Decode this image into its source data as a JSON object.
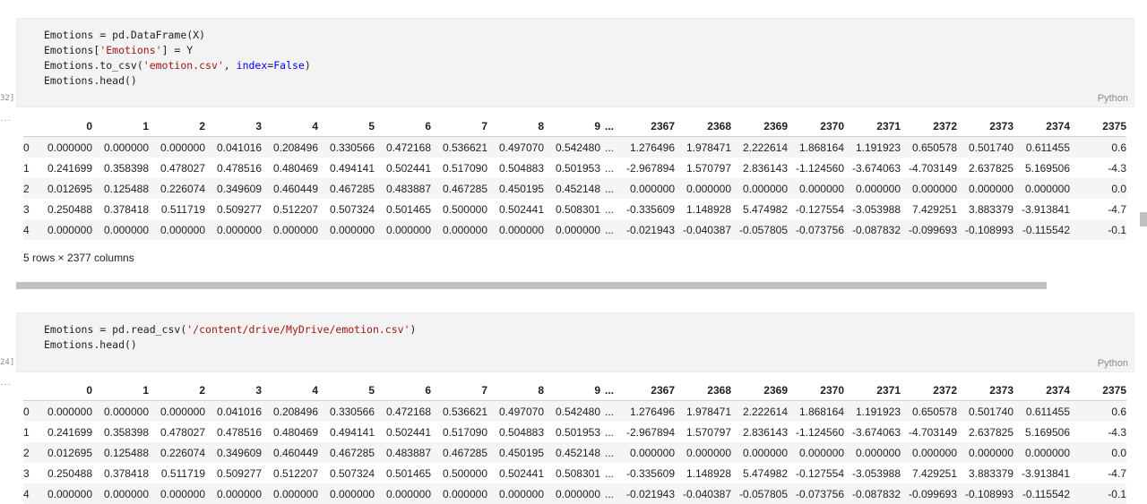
{
  "cell1": {
    "exec_count": "32]",
    "code_lines": [
      [
        [
          "p",
          "Emotions = pd.DataFrame(X)"
        ]
      ],
      [
        [
          "p",
          "Emotions["
        ],
        [
          "s",
          "'Emotions'"
        ],
        [
          "p",
          "] = Y"
        ]
      ],
      [
        [
          "p",
          "Emotions.to_csv("
        ],
        [
          "s",
          "'emotion.csv'"
        ],
        [
          "p",
          ", "
        ],
        [
          "k",
          "index"
        ],
        [
          "p",
          "="
        ],
        [
          "k",
          "False"
        ],
        [
          "p",
          ")"
        ]
      ],
      [
        [
          "p",
          "Emotions.head()"
        ]
      ]
    ],
    "language": "Python",
    "output_indicator": "..."
  },
  "cell2": {
    "exec_count": "24]",
    "code_lines": [
      [
        [
          "p",
          "Emotions = pd.read_csv("
        ],
        [
          "s",
          "'/content/drive/MyDrive/emotion.csv'"
        ],
        [
          "p",
          ")"
        ]
      ],
      [
        [
          "p",
          "Emotions.head()"
        ]
      ]
    ],
    "language": "Python",
    "output_indicator": "..."
  },
  "dataframe": {
    "columns": [
      "0",
      "1",
      "2",
      "3",
      "4",
      "5",
      "6",
      "7",
      "8",
      "9",
      "...",
      "2367",
      "2368",
      "2369",
      "2370",
      "2371",
      "2372",
      "2373",
      "2374",
      "2375"
    ],
    "rows": [
      {
        "index": "0",
        "values": [
          "0.000000",
          "0.000000",
          "0.000000",
          "0.041016",
          "0.208496",
          "0.330566",
          "0.472168",
          "0.536621",
          "0.497070",
          "0.542480",
          "...",
          "1.276496",
          "1.978471",
          "2.222614",
          "1.868164",
          "1.191923",
          "0.650578",
          "0.501740",
          "0.611455",
          "0.6"
        ]
      },
      {
        "index": "1",
        "values": [
          "0.241699",
          "0.358398",
          "0.478027",
          "0.478516",
          "0.480469",
          "0.494141",
          "0.502441",
          "0.517090",
          "0.504883",
          "0.501953",
          "...",
          "-2.967894",
          "1.570797",
          "2.836143",
          "-1.124560",
          "-3.674063",
          "-4.703149",
          "2.637825",
          "5.169506",
          "-4.3"
        ]
      },
      {
        "index": "2",
        "values": [
          "0.012695",
          "0.125488",
          "0.226074",
          "0.349609",
          "0.460449",
          "0.467285",
          "0.483887",
          "0.467285",
          "0.450195",
          "0.452148",
          "...",
          "0.000000",
          "0.000000",
          "0.000000",
          "0.000000",
          "0.000000",
          "0.000000",
          "0.000000",
          "0.000000",
          "0.0"
        ]
      },
      {
        "index": "3",
        "values": [
          "0.250488",
          "0.378418",
          "0.511719",
          "0.509277",
          "0.512207",
          "0.507324",
          "0.501465",
          "0.500000",
          "0.502441",
          "0.508301",
          "...",
          "-0.335609",
          "1.148928",
          "5.474982",
          "-0.127554",
          "-3.053988",
          "7.429251",
          "3.883379",
          "-3.913841",
          "-4.7"
        ]
      },
      {
        "index": "4",
        "values": [
          "0.000000",
          "0.000000",
          "0.000000",
          "0.000000",
          "0.000000",
          "0.000000",
          "0.000000",
          "0.000000",
          "0.000000",
          "0.000000",
          "...",
          "-0.021943",
          "-0.040387",
          "-0.057805",
          "-0.073756",
          "-0.087832",
          "-0.099693",
          "-0.108993",
          "-0.115542",
          "-0.1"
        ]
      }
    ],
    "shape_text": "5 rows × 2377 columns"
  }
}
